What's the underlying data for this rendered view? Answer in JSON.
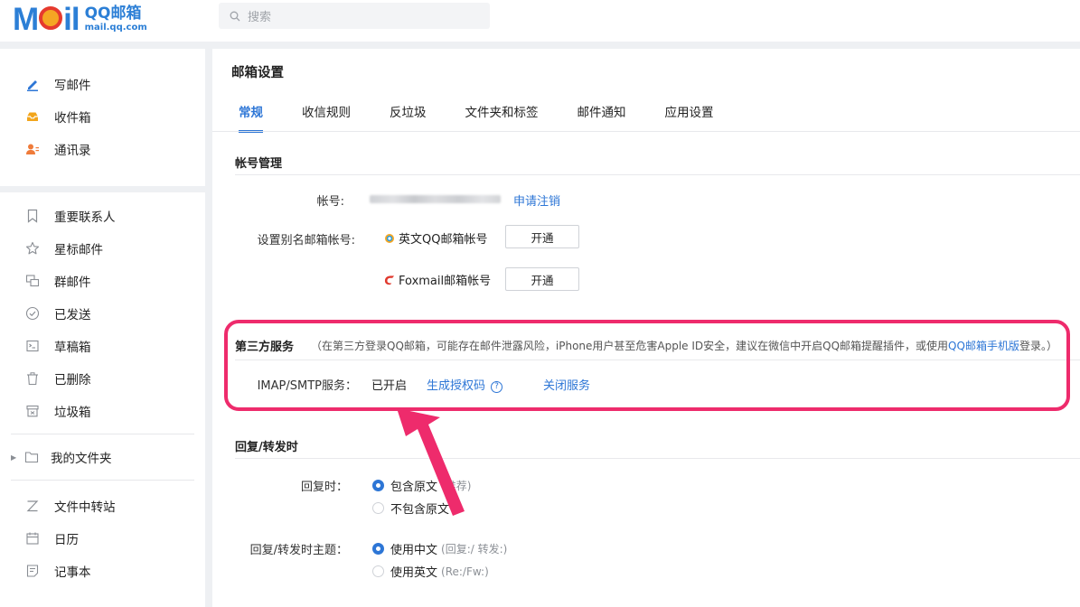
{
  "topbar": {
    "logo_word": "MOil",
    "logo_cn": "QQ邮箱",
    "logo_domain": "mail.qq.com",
    "search_placeholder": "搜索"
  },
  "sidebar": {
    "primary": [
      {
        "label": "写邮件",
        "icon": "compose-icon"
      },
      {
        "label": "收件箱",
        "icon": "inbox-icon"
      },
      {
        "label": "通讯录",
        "icon": "contacts-icon"
      }
    ],
    "secondary": [
      {
        "label": "重要联系人",
        "icon": "bookmark-icon"
      },
      {
        "label": "星标邮件",
        "icon": "star-icon"
      },
      {
        "label": "群邮件",
        "icon": "group-mail-icon"
      },
      {
        "label": "已发送",
        "icon": "sent-check-icon"
      },
      {
        "label": "草稿箱",
        "icon": "draft-icon"
      },
      {
        "label": "已删除",
        "icon": "trash-icon"
      },
      {
        "label": "垃圾箱",
        "icon": "spam-box-icon"
      }
    ],
    "folder": {
      "label": "我的文件夹",
      "icon": "folder-icon"
    },
    "tools": [
      {
        "label": "文件中转站",
        "icon": "transfer-icon"
      },
      {
        "label": "日历",
        "icon": "calendar-icon"
      },
      {
        "label": "记事本",
        "icon": "notepad-icon"
      }
    ]
  },
  "main": {
    "title": "邮箱设置",
    "tabs": [
      "常规",
      "收信规则",
      "反垃圾",
      "文件夹和标签",
      "邮件通知",
      "应用设置"
    ],
    "active_tab": "常规",
    "account_section": {
      "title": "帐号管理",
      "account_label": "帐号:",
      "cancel_link": "申请注销",
      "alias_label": "设置别名邮箱帐号:",
      "alias_items": [
        {
          "name": "英文QQ邮箱帐号",
          "button": "开通",
          "icon": "qq-alias-icon"
        },
        {
          "name": "Foxmail邮箱帐号",
          "button": "开通",
          "icon": "foxmail-icon"
        }
      ]
    },
    "third_party": {
      "title": "第三方服务",
      "note_prefix": "（在第三方登录QQ邮箱，可能存在邮件泄露风险，iPhone用户甚至危害Apple ID安全，建议在微信中开启QQ邮箱提醒插件，或使用",
      "note_link": "QQ邮箱手机版",
      "note_suffix": "登录。）",
      "imap_label": "IMAP/SMTP服务：",
      "imap_status": "已开启",
      "gen_code_link": "生成授权码",
      "close_link": "关闭服务"
    },
    "reply_section": {
      "title": "回复/转发时",
      "reply_label": "回复时：",
      "reply_options": [
        {
          "text": "包含原文",
          "hint": "(推荐)",
          "selected": true
        },
        {
          "text": "不包含原文",
          "hint": "",
          "selected": false
        }
      ],
      "subject_label": "回复/转发时主题：",
      "subject_options": [
        {
          "text": "使用中文",
          "hint": "(回复:/ 转发:)",
          "selected": true
        },
        {
          "text": "使用英文",
          "hint": "(Re:/Fw:)",
          "selected": false
        }
      ]
    }
  },
  "colors": {
    "accent": "#2d76d6",
    "annotation": "#ee2b6c"
  }
}
